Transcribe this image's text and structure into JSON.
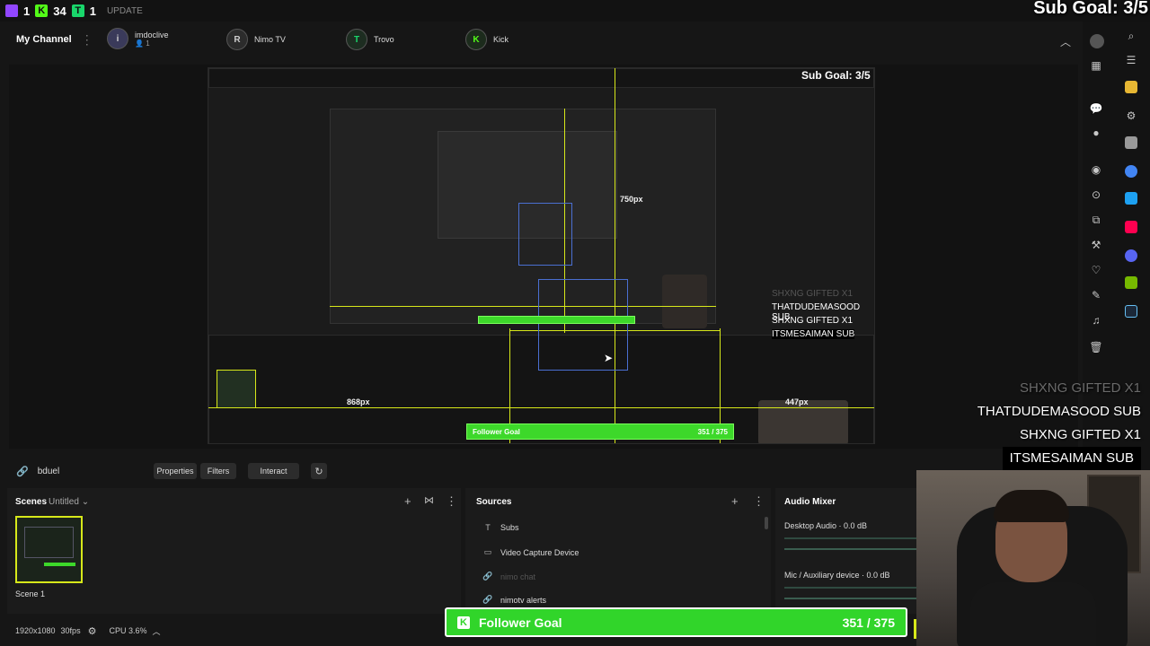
{
  "titlebar": {
    "viewer_count": "1",
    "kick_count": "34",
    "trovo_count": "1",
    "update_label": "UPDATE"
  },
  "channelbar": {
    "my_channel": "My Channel",
    "channels": [
      {
        "name": "imdoclive",
        "sub": "1",
        "initial": "i"
      },
      {
        "name": "Nimo TV",
        "initial": "R"
      },
      {
        "name": "Trovo",
        "initial": "T"
      },
      {
        "name": "Kick",
        "initial": "K"
      }
    ]
  },
  "overlays": {
    "sub_goal": "Sub Goal: 3/5",
    "events": [
      {
        "text": "SHXNG  GIFTED X1",
        "faded": true
      },
      {
        "text": "THATDUDEMASOOD  SUB",
        "faded": false
      },
      {
        "text": "SHXNG  GIFTED X1",
        "faded": false
      },
      {
        "text": "ITSMESAIMAN  SUB",
        "faded": false
      }
    ],
    "follower_goal": {
      "label": "Follower Goal",
      "count": "351 / 375",
      "current": 351,
      "target": 375
    }
  },
  "preview": {
    "dim_868": "868px",
    "dim_750": "750px",
    "dim_447": "447px"
  },
  "sourcebar": {
    "source_name": "bduel",
    "properties": "Properties",
    "filters": "Filters",
    "interact": "Interact"
  },
  "scenes": {
    "title": "Scenes",
    "collection": "Untitled",
    "items": [
      {
        "label": "Scene 1"
      }
    ]
  },
  "sources": {
    "title": "Sources",
    "items": [
      {
        "label": "Subs",
        "icon": "text-icon",
        "dim": false
      },
      {
        "label": "Video Capture Device",
        "icon": "camera-icon",
        "dim": false
      },
      {
        "label": "nimo chat",
        "icon": "link-icon",
        "dim": true
      },
      {
        "label": "nimotv alerts",
        "icon": "link-icon",
        "dim": false
      }
    ]
  },
  "mixer": {
    "title": "Audio Mixer",
    "channels": [
      {
        "label": "Desktop Audio · 0.0 dB"
      },
      {
        "label": "Mic / Auxiliary device · 0.0 dB"
      }
    ]
  },
  "status": {
    "resolution": "1920x1080",
    "fps": "30fps",
    "cpu": "CPU 3.6%"
  },
  "colors": {
    "kick_green": "#31d52a",
    "guide_yellow": "#d7e81a",
    "twitch_purple": "#9146ff"
  }
}
